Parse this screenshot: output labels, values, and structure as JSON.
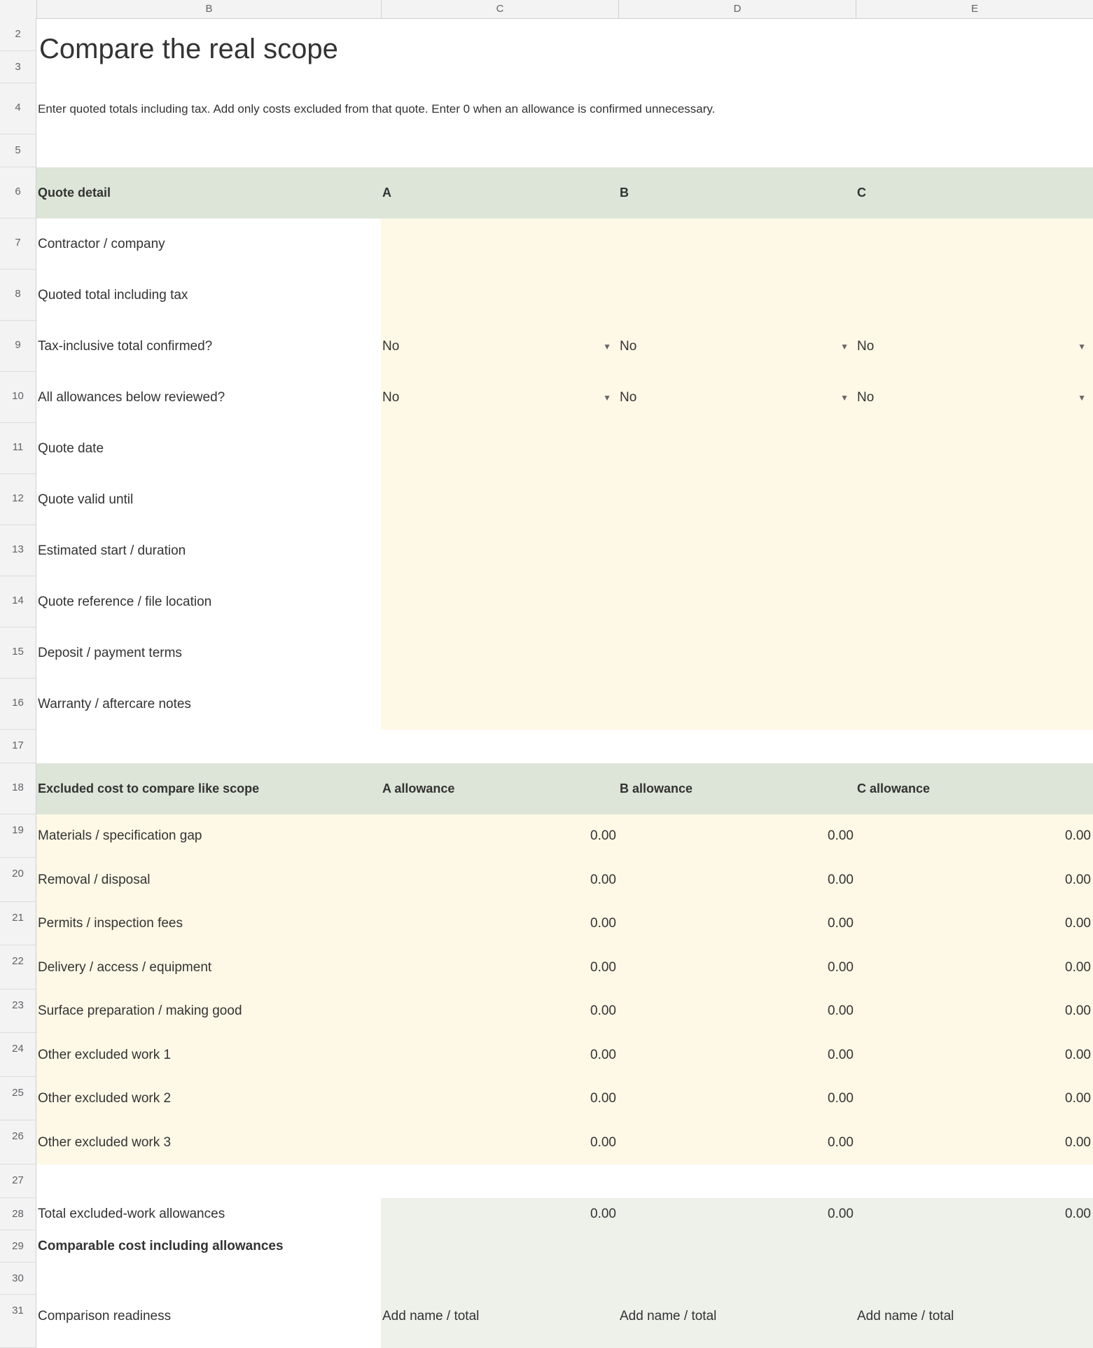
{
  "columns": [
    "B",
    "C",
    "D",
    "E"
  ],
  "title": "Compare the real scope",
  "instructions": "Enter quoted totals including tax. Add only costs excluded from that quote. Enter 0 when an allowance is confirmed unnecessary.",
  "rows": {
    "r2": "2",
    "r3": "3",
    "r4": "4",
    "r5": "5",
    "r6": "6",
    "r7": "7",
    "r8": "8",
    "r9": "9",
    "r10": "10",
    "r11": "11",
    "r12": "12",
    "r13": "13",
    "r14": "14",
    "r15": "15",
    "r16": "16",
    "r17": "17",
    "r18": "18",
    "r19": "19",
    "r20": "20",
    "r21": "21",
    "r22": "22",
    "r23": "23",
    "r24": "24",
    "r25": "25",
    "r26": "26",
    "r27": "27",
    "r28": "28",
    "r29": "29",
    "r30": "30",
    "r31": "31"
  },
  "quote_table": {
    "header": [
      "Quote detail",
      "A",
      "B",
      "C"
    ],
    "labels": {
      "contractor": "Contractor / company",
      "quoted_total": "Quoted total including tax",
      "tax_confirmed": "Tax-inclusive total confirmed?",
      "allowances_reviewed": "All allowances below reviewed?",
      "quote_date": "Quote date",
      "valid_until": "Quote valid until",
      "start_duration": "Estimated start / duration",
      "reference": "Quote reference / file location",
      "deposit": "Deposit / payment terms",
      "warranty": "Warranty / aftercare notes"
    },
    "tax_confirmed_values": [
      "No",
      "No",
      "No"
    ],
    "allowances_reviewed_values": [
      "No",
      "No",
      "No"
    ],
    "dropdown_caret": "▼"
  },
  "excluded_table": {
    "header": [
      "Excluded cost to compare like scope",
      "A allowance",
      "B allowance",
      "C allowance"
    ],
    "items": [
      {
        "label": "Materials / specification gap",
        "values": [
          "0.00",
          "0.00",
          "0.00"
        ]
      },
      {
        "label": "Removal / disposal",
        "values": [
          "0.00",
          "0.00",
          "0.00"
        ]
      },
      {
        "label": "Permits / inspection fees",
        "values": [
          "0.00",
          "0.00",
          "0.00"
        ]
      },
      {
        "label": "Delivery / access / equipment",
        "values": [
          "0.00",
          "0.00",
          "0.00"
        ]
      },
      {
        "label": "Surface preparation / making good",
        "values": [
          "0.00",
          "0.00",
          "0.00"
        ]
      },
      {
        "label": "Other excluded work 1",
        "values": [
          "0.00",
          "0.00",
          "0.00"
        ]
      },
      {
        "label": "Other excluded work 2",
        "values": [
          "0.00",
          "0.00",
          "0.00"
        ]
      },
      {
        "label": "Other excluded work 3",
        "values": [
          "0.00",
          "0.00",
          "0.00"
        ]
      }
    ]
  },
  "totals": {
    "total_label": "Total excluded-work allowances",
    "total_values": [
      "0.00",
      "0.00",
      "0.00"
    ],
    "comparable_label": "Comparable cost including allowances",
    "readiness_label": "Comparison readiness",
    "readiness_values": [
      "Add name / total",
      "Add name / total",
      "Add name / total"
    ]
  },
  "colors": {
    "header_fill": "#dce5d8",
    "input_fill": "#fef8e6",
    "total_fill": "#eef0ea"
  }
}
